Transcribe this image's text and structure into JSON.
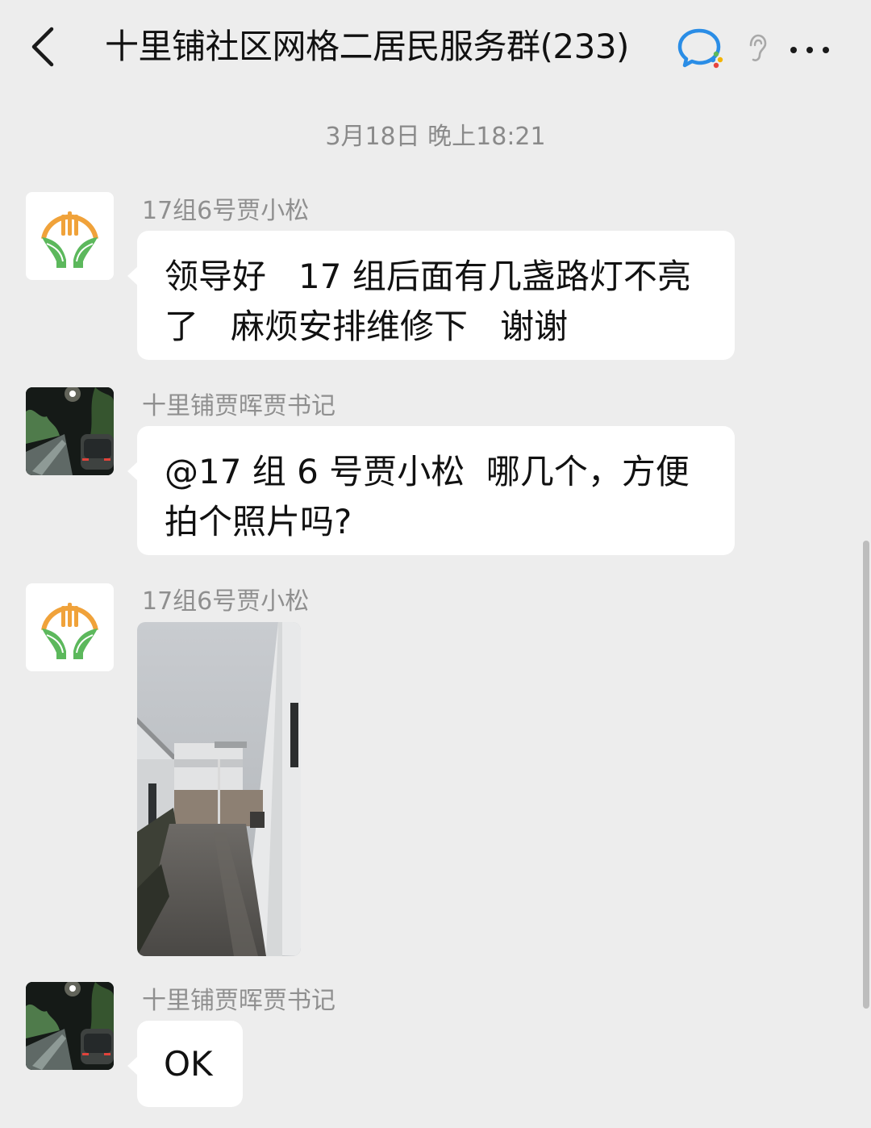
{
  "header": {
    "title": "十里铺社区网格二居民服务群(233)",
    "back_icon": "chevron-left-icon",
    "wecom_icon": "wecom-chat-icon",
    "ear_icon": "ear-icon",
    "more_icon": "ellipsis-icon"
  },
  "timestamp": "3月18日 晚上18:21",
  "messages": [
    {
      "sender": "17组6号贾小松",
      "avatar": "grain-logo-avatar",
      "type": "text",
      "text": "领导好   17 组后面有几盏路灯不亮了   麻烦安排维修下   谢谢"
    },
    {
      "sender": "十里铺贾晖贾书记",
      "avatar": "night-street-avatar",
      "type": "text",
      "text": "@17 组 6 号贾小松  哪几个，方便拍个照片吗?"
    },
    {
      "sender": "17组6号贾小松",
      "avatar": "grain-logo-avatar",
      "type": "image",
      "image": "alley-photo"
    },
    {
      "sender": "十里铺贾晖贾书记",
      "avatar": "night-street-avatar",
      "type": "text",
      "text": "OK"
    }
  ],
  "colors": {
    "background": "#ededed",
    "bubble": "#ffffff",
    "name": "#8f8f8f",
    "logo_orange": "#f0a23a",
    "logo_green": "#5cb85c"
  }
}
